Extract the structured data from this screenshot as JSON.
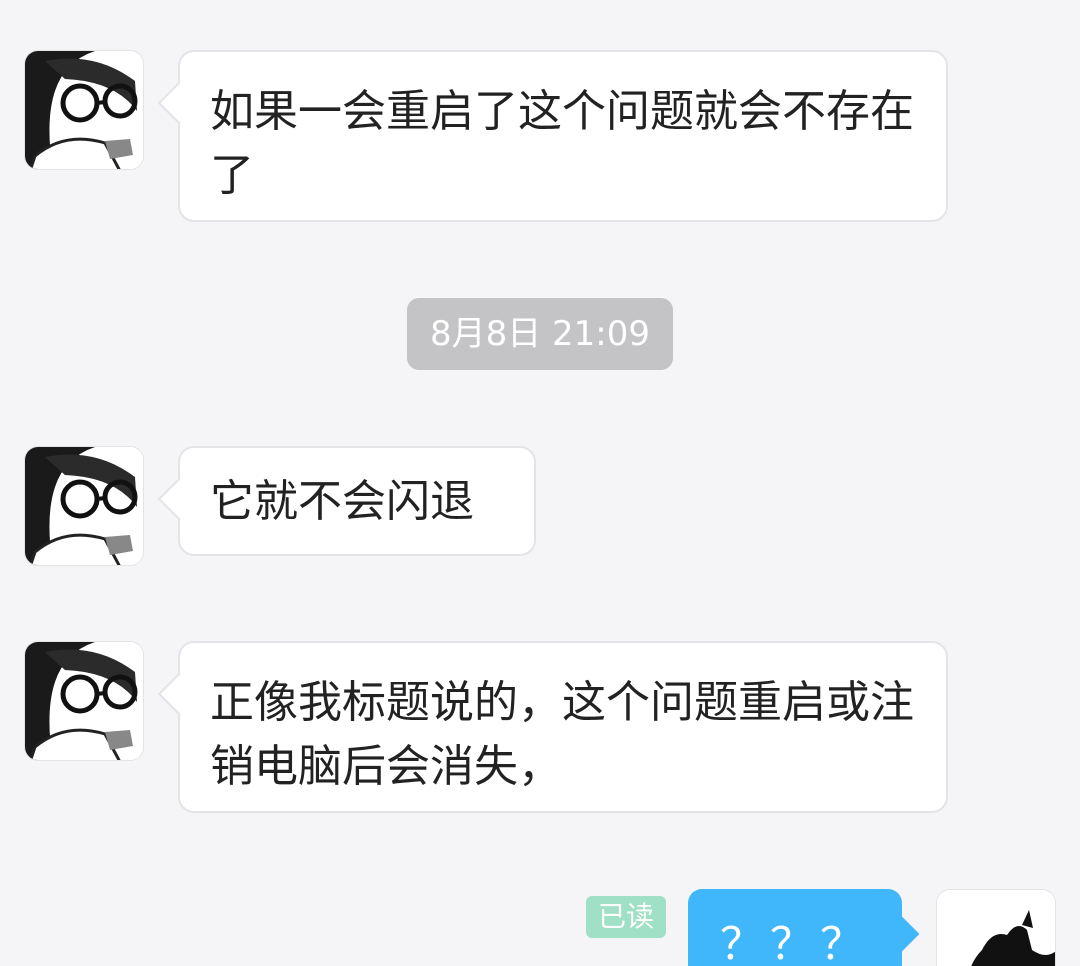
{
  "messages": [
    {
      "sender": "other",
      "text": "如果一会重启了这个问题就会不存在了"
    },
    {
      "sender": "other",
      "text": "它就不会闪退"
    },
    {
      "sender": "other",
      "text": "正像我标题说的，这个问题重启或注销电脑后会消失，"
    },
    {
      "sender": "me",
      "text": "？？？"
    }
  ],
  "timestamp": "8月8日 21:09",
  "read_status": "已读",
  "colors": {
    "background": "#f5f5f7",
    "sent_bubble": "#40b6fb",
    "received_bubble": "#ffffff",
    "timestamp_pill": "#c4c4c7",
    "read_badge": "#9fe0c6"
  }
}
